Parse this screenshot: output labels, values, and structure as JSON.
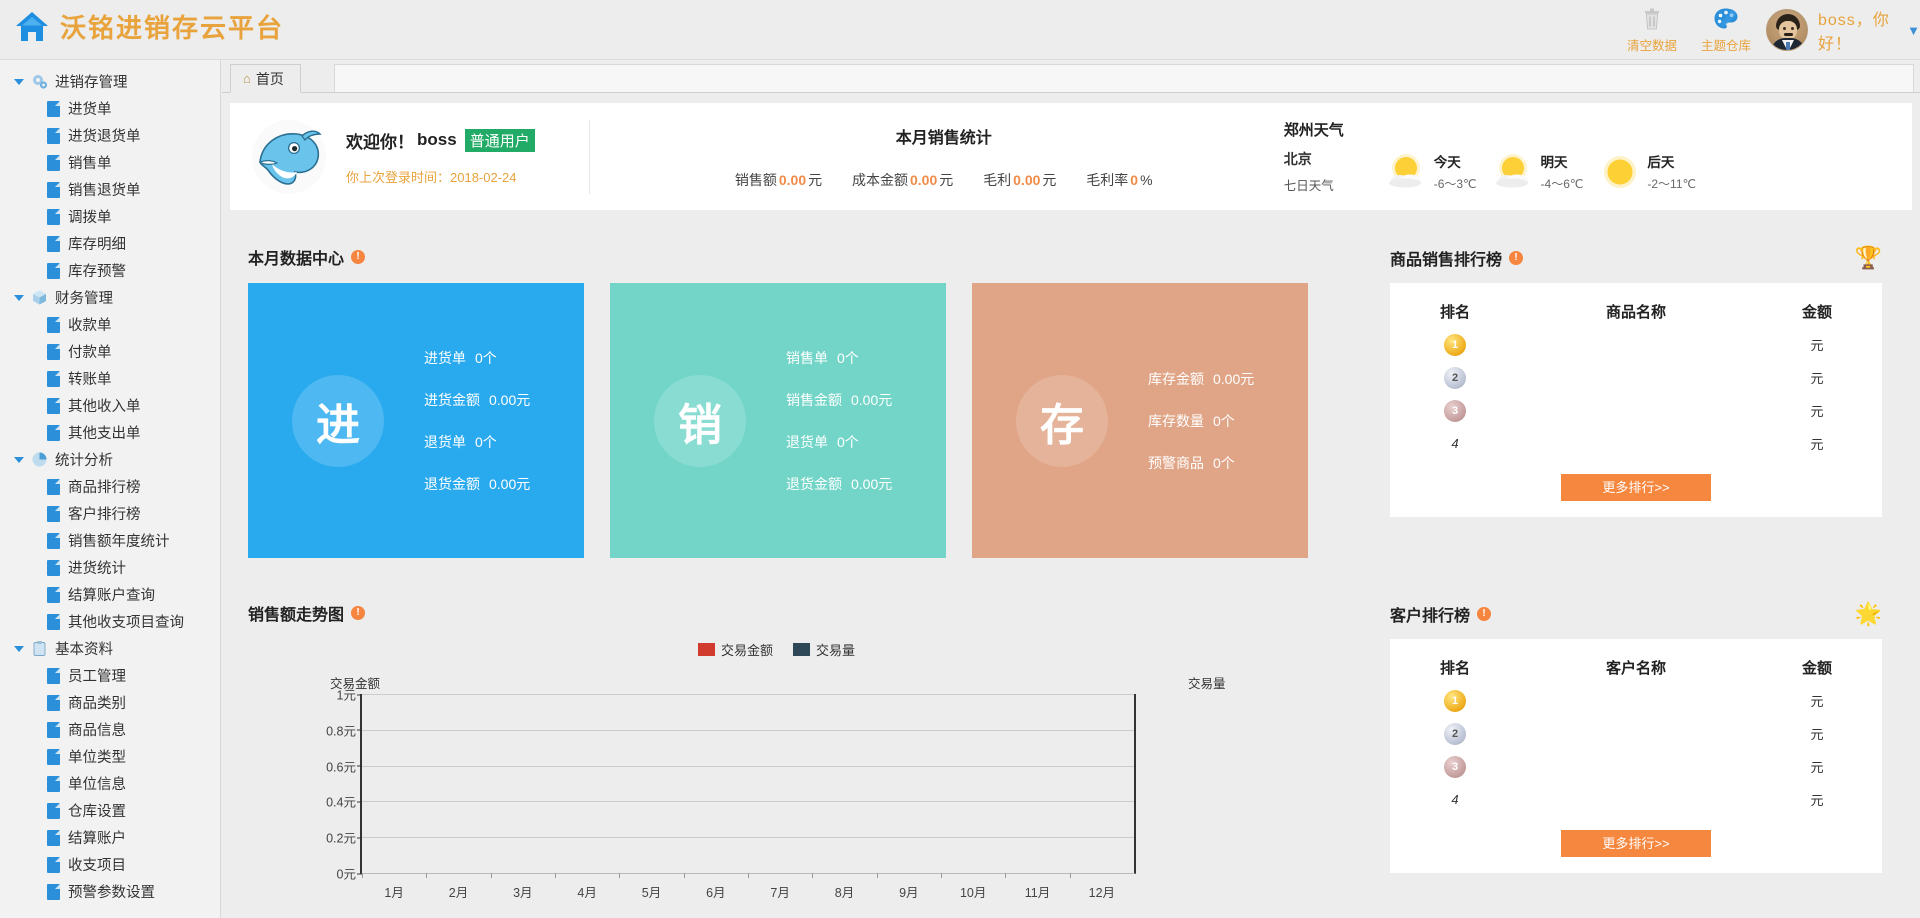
{
  "header": {
    "brand_title": "沃铭进销存云平台",
    "home_icon": "home-icon",
    "tools": [
      {
        "icon": "trash-icon",
        "label": "清空数据"
      },
      {
        "icon": "palette-icon",
        "label": "主题仓库"
      }
    ],
    "user": {
      "greeting": "boss，你好！",
      "caret": "▼",
      "avatar": "user-avatar"
    }
  },
  "sidebar": {
    "groups": [
      {
        "label": "进销存管理",
        "icon": "gears-icon",
        "items": [
          "进货单",
          "进货退货单",
          "销售单",
          "销售退货单",
          "调拨单",
          "库存明细",
          "库存预警"
        ]
      },
      {
        "label": "财务管理",
        "icon": "cube-icon",
        "items": [
          "收款单",
          "付款单",
          "转账单",
          "其他收入单",
          "其他支出单"
        ]
      },
      {
        "label": "统计分析",
        "icon": "piechart-icon",
        "items": [
          "商品排行榜",
          "客户排行榜",
          "销售额年度统计",
          "进货统计",
          "结算账户查询",
          "其他收支项目查询"
        ]
      },
      {
        "label": "基本资料",
        "icon": "clipboard-icon",
        "items": [
          "员工管理",
          "商品类别",
          "商品信息",
          "单位类型",
          "单位信息",
          "仓库设置",
          "结算账户",
          "收支项目",
          "预警参数设置"
        ]
      }
    ]
  },
  "tabs": [
    {
      "label": "首页",
      "icon": "home-icon",
      "active": true
    }
  ],
  "welcome": {
    "avatar_icon": "dolphin-icon",
    "greeting_prefix": "欢迎你！",
    "username": "boss",
    "role_badge": "普通用户",
    "last_login_label": "你上次登录时间：",
    "last_login_value": "2018-02-24"
  },
  "sales_stat": {
    "title": "本月销售统计",
    "items": [
      {
        "label": "销售额",
        "value": "0.00",
        "unit": "元"
      },
      {
        "label": "成本金额",
        "value": "0.00",
        "unit": "元"
      },
      {
        "label": "毛利",
        "value": "0.00",
        "unit": "元"
      },
      {
        "label": "毛利率",
        "value": "0",
        "unit": "%"
      }
    ]
  },
  "weather": {
    "title": "郑州天气",
    "city": "北京",
    "seven_day": "七日天气",
    "days": [
      {
        "name": "今天",
        "temp": "-6～3℃",
        "icon": "sun-cloud-icon"
      },
      {
        "name": "明天",
        "temp": "-4～6℃",
        "icon": "sun-cloud-icon"
      },
      {
        "name": "后天",
        "temp": "-2～11℃",
        "icon": "sun-icon"
      }
    ]
  },
  "data_center": {
    "title": "本月数据中心",
    "cards": [
      {
        "glyph": "进",
        "color": "#2aaaee",
        "rows": [
          {
            "label": "进货单",
            "value": "0个"
          },
          {
            "label": "进货金额",
            "value": "0.00元"
          },
          {
            "label": "退货单",
            "value": "0个"
          },
          {
            "label": "退货金额",
            "value": "0.00元"
          }
        ]
      },
      {
        "glyph": "销",
        "color": "#72d5c8",
        "rows": [
          {
            "label": "销售单",
            "value": "0个"
          },
          {
            "label": "销售金额",
            "value": "0.00元"
          },
          {
            "label": "退货单",
            "value": "0个"
          },
          {
            "label": "退货金额",
            "value": "0.00元"
          }
        ]
      },
      {
        "glyph": "存",
        "color": "#e0a486",
        "rows": [
          {
            "label": "库存金额",
            "value": "0.00元"
          },
          {
            "label": "库存数量",
            "value": "0个"
          },
          {
            "label": "预警商品",
            "value": "0个"
          }
        ]
      }
    ]
  },
  "chart_data": {
    "type": "line",
    "title": "销售额走势图",
    "xlabel": "",
    "ylabel": "交易金额",
    "y2label": "交易量",
    "ylim": [
      0,
      1
    ],
    "yticks": [
      "0元",
      "0.2元",
      "0.4元",
      "0.6元",
      "0.8元",
      "1元"
    ],
    "grid": true,
    "legend_position": "top-center",
    "categories": [
      "1月",
      "2月",
      "3月",
      "4月",
      "5月",
      "6月",
      "7月",
      "8月",
      "9月",
      "10月",
      "11月",
      "12月"
    ],
    "series": [
      {
        "name": "交易金额",
        "color": "#d03b2e",
        "values": [
          0,
          0,
          0,
          0,
          0,
          0,
          0,
          0,
          0,
          0,
          0,
          0
        ]
      },
      {
        "name": "交易量",
        "color": "#2f4858",
        "values": [
          0,
          0,
          0,
          0,
          0,
          0,
          0,
          0,
          0,
          0,
          0,
          0
        ]
      }
    ]
  },
  "product_rank": {
    "title": "商品销售排行榜",
    "badge_icon": "trophy-icon",
    "columns": [
      "排名",
      "商品名称",
      "金额"
    ],
    "rows": [
      {
        "rank": "1",
        "name": "",
        "amount": "元"
      },
      {
        "rank": "2",
        "name": "",
        "amount": "元"
      },
      {
        "rank": "3",
        "name": "",
        "amount": "元"
      },
      {
        "rank": "4",
        "name": "",
        "amount": "元"
      }
    ],
    "more_label": "更多排行>>"
  },
  "customer_rank": {
    "title": "客户排行榜",
    "badge_icon": "star-icon",
    "columns": [
      "排名",
      "客户名称",
      "金额"
    ],
    "rows": [
      {
        "rank": "1",
        "name": "",
        "amount": "元"
      },
      {
        "rank": "2",
        "name": "",
        "amount": "元"
      },
      {
        "rank": "3",
        "name": "",
        "amount": "元"
      },
      {
        "rank": "4",
        "name": "",
        "amount": "元"
      }
    ],
    "more_label": "更多排行>>"
  },
  "colors": {
    "brand": "#e8a33d",
    "accent_orange": "#f5873f",
    "blue": "#2aaaee",
    "teal": "#72d5c8",
    "tan": "#e0a486",
    "green_badge": "#22ab66"
  }
}
